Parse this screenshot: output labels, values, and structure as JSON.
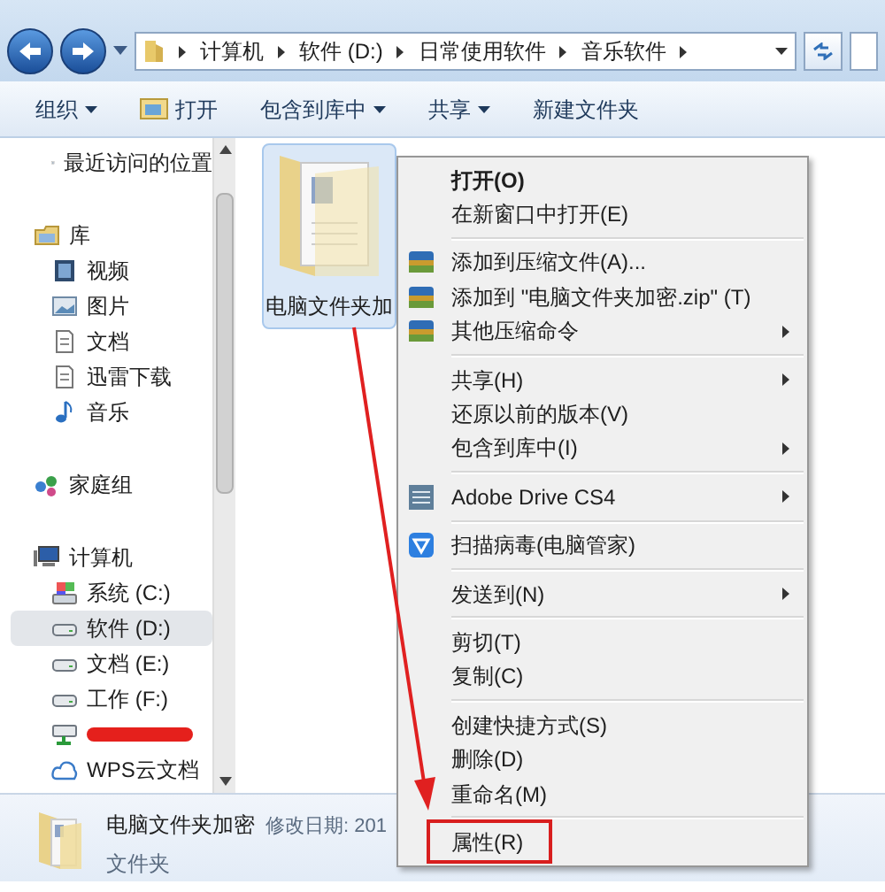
{
  "breadcrumb": [
    "计算机",
    "软件 (D:)",
    "日常使用软件",
    "音乐软件"
  ],
  "toolbar": [
    "组织",
    "打开",
    "包含到库中",
    "共享",
    "新建文件夹"
  ],
  "nav": [
    {
      "children": [
        {
          "label": "最近访问的位置",
          "selected": false
        }
      ]
    },
    {
      "label": "库",
      "selected": false,
      "children": [
        {
          "label": "视频",
          "selected": false
        },
        {
          "label": "图片",
          "selected": false
        },
        {
          "label": "文档",
          "selected": false
        },
        {
          "label": "迅雷下载",
          "selected": false
        },
        {
          "label": "音乐",
          "selected": false
        }
      ]
    },
    {
      "label": "家庭组",
      "selected": false
    },
    {
      "label": "计算机",
      "selected": false,
      "children": [
        {
          "label": "系统 (C:)",
          "selected": false
        },
        {
          "label": "软件 (D:)",
          "selected": true
        },
        {
          "label": "文档 (E:)",
          "selected": false
        },
        {
          "label": "工作 (F:)",
          "selected": false
        },
        {
          "kind": "redacted"
        },
        {
          "label": "WPS云文档",
          "selected": false
        }
      ]
    }
  ],
  "folder": {
    "label": "电脑文件夹加",
    "selected": true
  },
  "menu": [
    {
      "kind": "item",
      "label": "打开(O)",
      "bold": true
    },
    {
      "kind": "item",
      "label": "在新窗口中打开(E)"
    },
    {
      "kind": "separator"
    },
    {
      "kind": "item",
      "label": "添加到压缩文件(A)..."
    },
    {
      "kind": "item",
      "label": "添加到 \"电脑文件夹加密.zip\" (T)"
    },
    {
      "kind": "item",
      "label": "其他压缩命令",
      "submenu": true
    },
    {
      "kind": "separator"
    },
    {
      "kind": "item",
      "label": "共享(H)",
      "submenu": true
    },
    {
      "kind": "item",
      "label": "还原以前的版本(V)"
    },
    {
      "kind": "item",
      "label": "包含到库中(I)",
      "submenu": true
    },
    {
      "kind": "separator"
    },
    {
      "kind": "item",
      "label": "Adobe Drive CS4",
      "submenu": true
    },
    {
      "kind": "separator"
    },
    {
      "kind": "item",
      "label": "扫描病毒(电脑管家)"
    },
    {
      "kind": "separator"
    },
    {
      "kind": "item",
      "label": "发送到(N)",
      "submenu": true
    },
    {
      "kind": "separator"
    },
    {
      "kind": "item",
      "label": "剪切(T)"
    },
    {
      "kind": "item",
      "label": "复制(C)"
    },
    {
      "kind": "separator"
    },
    {
      "kind": "item",
      "label": "创建快捷方式(S)"
    },
    {
      "kind": "item",
      "label": "删除(D)"
    },
    {
      "kind": "item",
      "label": "重命名(M)"
    },
    {
      "kind": "separator"
    },
    {
      "kind": "item",
      "label": "属性(R)",
      "highlighted": true
    }
  ],
  "details": {
    "name": "电脑文件夹加密",
    "meta": "修改日期: 201",
    "type": "文件夹"
  }
}
